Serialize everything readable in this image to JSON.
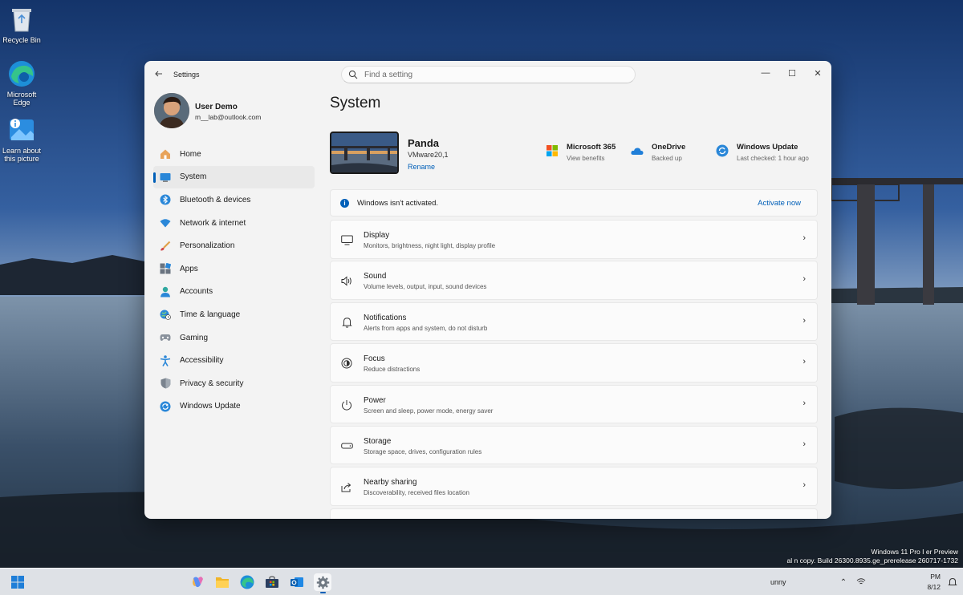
{
  "desktop": {
    "icons": [
      {
        "label": "Recycle Bin",
        "icon": "recycle-bin-icon"
      },
      {
        "label": "Microsoft Edge",
        "icon": "edge-icon"
      },
      {
        "label": "Learn about this picture",
        "icon": "info-icon"
      }
    ],
    "watermark": {
      "line1": "Windows 11 Pro I    er Preview",
      "line2": "al     n copy. Build 26300.8935.ge_prerelease    260717-1732"
    }
  },
  "window": {
    "app_title": "Settings",
    "search_placeholder": "Find a setting",
    "caption": {
      "minimize": "—",
      "maximize": "☐",
      "close": "✕"
    },
    "profile": {
      "name": "User Demo",
      "email": "m__lab@outlook.com"
    },
    "nav": [
      {
        "label": "Home",
        "icon": "home-icon",
        "active": false
      },
      {
        "label": "System",
        "icon": "system-icon",
        "active": true
      },
      {
        "label": "Bluetooth & devices",
        "icon": "bluetooth-icon",
        "active": false
      },
      {
        "label": "Network & internet",
        "icon": "wifi-icon",
        "active": false
      },
      {
        "label": "Personalization",
        "icon": "brush-icon",
        "active": false
      },
      {
        "label": "Apps",
        "icon": "apps-icon",
        "active": false
      },
      {
        "label": "Accounts",
        "icon": "accounts-icon",
        "active": false
      },
      {
        "label": "Time & language",
        "icon": "globe-clock-icon",
        "active": false
      },
      {
        "label": "Gaming",
        "icon": "gamepad-icon",
        "active": false
      },
      {
        "label": "Accessibility",
        "icon": "accessibility-icon",
        "active": false
      },
      {
        "label": "Privacy & security",
        "icon": "shield-icon",
        "active": false
      },
      {
        "label": "Windows Update",
        "icon": "update-icon",
        "active": false
      }
    ],
    "page_title": "System",
    "device": {
      "name": "Panda",
      "model": "VMware20,1",
      "rename": "Rename"
    },
    "quick": [
      {
        "title": "Microsoft 365",
        "sub": "View benefits",
        "icon": "microsoft-365-icon"
      },
      {
        "title": "OneDrive",
        "sub": "Backed up",
        "icon": "onedrive-icon"
      },
      {
        "title": "Windows Update",
        "sub": "Last checked: 1 hour ago",
        "icon": "windows-update-icon"
      }
    ],
    "banner": {
      "text": "Windows isn't activated.",
      "action": "Activate now"
    },
    "cards": [
      {
        "title": "Display",
        "sub": "Monitors, brightness, night light, display profile",
        "icon": "display-icon"
      },
      {
        "title": "Sound",
        "sub": "Volume levels, output, input, sound devices",
        "icon": "speaker-icon"
      },
      {
        "title": "Notifications",
        "sub": "Alerts from apps and system, do not disturb",
        "icon": "bell-icon"
      },
      {
        "title": "Focus",
        "sub": "Reduce distractions",
        "icon": "focus-icon"
      },
      {
        "title": "Power",
        "sub": "Screen and sleep, power mode, energy saver",
        "icon": "power-icon"
      },
      {
        "title": "Storage",
        "sub": "Storage space, drives, configuration rules",
        "icon": "storage-icon"
      },
      {
        "title": "Nearby sharing",
        "sub": "Discoverability, received files location",
        "icon": "share-icon"
      }
    ]
  },
  "taskbar": {
    "weather_text": "unny",
    "clock_time": "PM",
    "clock_date": "8/12"
  },
  "colors": {
    "accent": "#005fb8",
    "window_bg": "#f3f3f3",
    "card_bg": "#fbfbfb"
  }
}
